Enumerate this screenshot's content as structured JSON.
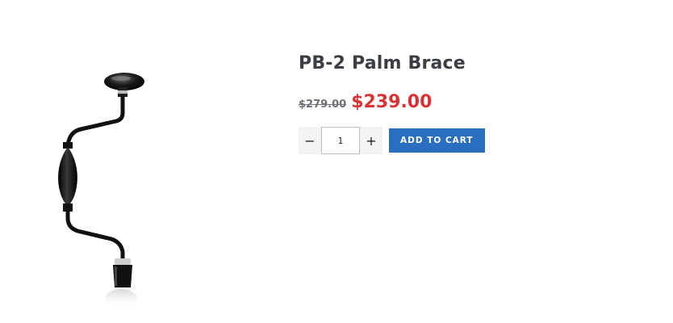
{
  "product": {
    "title": "PB-2 Palm Brace",
    "image_alt": "PB-2 Palm Brace",
    "old_price": "$279.00",
    "new_price": "$239.00",
    "quantity": "1",
    "decrement_symbol": "−",
    "increment_symbol": "+",
    "add_to_cart_label": "ADD TO CART"
  },
  "colors": {
    "title": "#3b3e43",
    "old_price": "#6e7177",
    "sale_price": "#d93232",
    "button": "#2a6ebf"
  },
  "icons": {
    "product_image": "palm-brace-drill-image"
  }
}
